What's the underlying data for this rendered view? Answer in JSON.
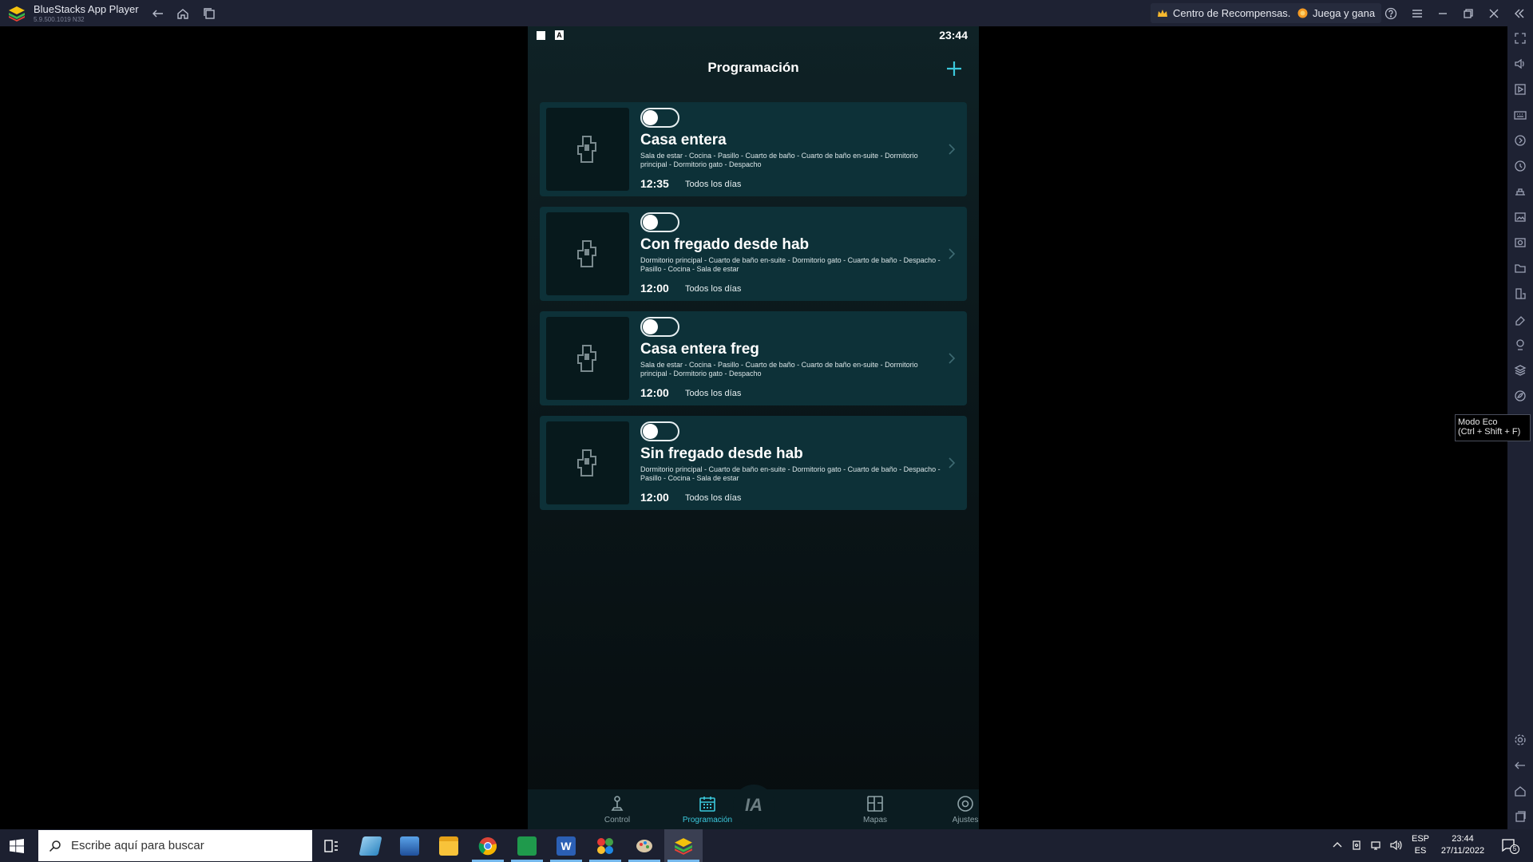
{
  "window": {
    "title": "BlueStacks App Player",
    "version": "5.9.500.1019 N32",
    "rewards_label": "Centro de Recompensas.",
    "play_earn_label": "Juega y gana"
  },
  "tooltip": {
    "line1": "Modo Eco",
    "line2": "(Ctrl + Shift + F)"
  },
  "android": {
    "status_time": "23:44",
    "page_title": "Programación",
    "schedules": [
      {
        "title": "Casa entera",
        "rooms": "Sala de estar - Cocina - Pasillo - Cuarto de baño - Cuarto de baño en-suite - Dormitorio principal - Dormitorio gato - Despacho",
        "time": "12:35",
        "days": "Todos los días",
        "enabled": false
      },
      {
        "title": "Con fregado desde hab",
        "rooms": "Dormitorio principal - Cuarto de baño en-suite - Dormitorio gato - Cuarto de baño - Despacho - Pasillo - Cocina - Sala de estar",
        "time": "12:00",
        "days": "Todos los días",
        "enabled": false
      },
      {
        "title": "Casa entera freg",
        "rooms": "Sala de estar - Cocina - Pasillo - Cuarto de baño - Cuarto de baño en-suite - Dormitorio principal - Dormitorio gato - Despacho",
        "time": "12:00",
        "days": "Todos los días",
        "enabled": false
      },
      {
        "title": "Sin fregado desde hab",
        "rooms": "Dormitorio principal - Cuarto de baño en-suite - Dormitorio gato - Cuarto de baño - Despacho - Pasillo - Cocina - Sala de estar",
        "time": "12:00",
        "days": "Todos los días",
        "enabled": false
      }
    ],
    "nav": {
      "control": "Control",
      "schedule": "Programación",
      "ai": "IA",
      "maps": "Mapas",
      "settings": "Ajustes",
      "active": "schedule"
    }
  },
  "taskbar": {
    "search_placeholder": "Escribe aquí para buscar",
    "lang_top": "ESP",
    "lang_bottom": "ES",
    "clock_time": "23:44",
    "clock_date": "27/11/2022",
    "notification_count": "5"
  },
  "colors": {
    "accent": "#3bc8dc",
    "card_bg": "#0d3138",
    "titlebar_bg": "#1e2233",
    "taskbar_bg": "#1c2030"
  }
}
